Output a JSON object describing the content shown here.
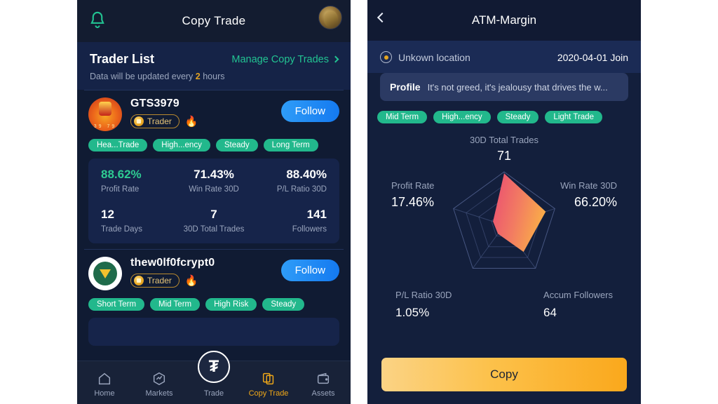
{
  "left": {
    "header": {
      "title": "Copy Trade",
      "bell_icon": "bell-icon",
      "avatar_icon": "user-avatar"
    },
    "list_header": {
      "title": "Trader List",
      "manage_label": "Manage Copy Trades",
      "subtitle_prefix": "Data will be updated every ",
      "subtitle_highlight": "2",
      "subtitle_suffix": " hours"
    },
    "traders": [
      {
        "name": "GTS3979",
        "badge_label": "Trader",
        "hot_icon": "flame-icon",
        "follow_label": "Follow",
        "avatar_caption": "39  79",
        "tags": [
          "Hea...Trade",
          "High...ency",
          "Steady",
          "Long Term"
        ],
        "stats_row1": [
          {
            "value": "88.62%",
            "label": "Profit Rate",
            "accent": "green"
          },
          {
            "value": "71.43%",
            "label": "Win Rate 30D",
            "accent": "white"
          },
          {
            "value": "88.40%",
            "label": "P/L Ratio 30D",
            "accent": "white"
          }
        ],
        "stats_row2": [
          {
            "value": "12",
            "label": "Trade Days",
            "accent": "white"
          },
          {
            "value": "7",
            "label": "30D Total Trades",
            "accent": "white"
          },
          {
            "value": "141",
            "label": "Followers",
            "accent": "white"
          }
        ]
      },
      {
        "name": "thew0lf0fcrypt0",
        "badge_label": "Trader",
        "hot_icon": "flame-icon",
        "follow_label": "Follow",
        "tags": [
          "Short Term",
          "Mid Term",
          "High Risk",
          "Steady"
        ]
      }
    ],
    "nav": {
      "fab_label": "₮",
      "items": [
        {
          "label": "Home",
          "icon": "home-icon",
          "active": false
        },
        {
          "label": "Markets",
          "icon": "markets-icon",
          "active": false
        },
        {
          "label": "Trade",
          "icon": "trade-icon",
          "active": false
        },
        {
          "label": "Copy Trade",
          "icon": "copy-trade-icon",
          "active": true
        },
        {
          "label": "Assets",
          "icon": "wallet-icon",
          "active": false
        }
      ]
    }
  },
  "right": {
    "header": {
      "title": "ATM-Margin",
      "back_icon": "chevron-left-icon"
    },
    "location": {
      "icon": "map-pin-icon",
      "text": "Unkown location",
      "join_date": "2020-04-01 Join"
    },
    "profile": {
      "key": "Profile",
      "value": "It's not greed, it's jealousy that drives the w..."
    },
    "tags": [
      "Mid Term",
      "High...ency",
      "Steady",
      "Light Trade"
    ],
    "total_trades": {
      "label": "30D Total Trades",
      "value": "71"
    },
    "side_left": {
      "label": "Profit Rate",
      "value": "17.46%"
    },
    "side_right": {
      "label": "Win Rate 30D",
      "value": "66.20%"
    },
    "bottom_left": {
      "label": "P/L Ratio 30D",
      "value": "1.05%"
    },
    "bottom_right": {
      "label": "Accum Followers",
      "value": "64"
    },
    "copy_label": "Copy"
  },
  "chart_data": {
    "type": "radar",
    "title": "Trader performance radar",
    "axes": [
      "30D Total Trades",
      "Win Rate 30D",
      "Accum Followers",
      "P/L Ratio 30D",
      "Profit Rate"
    ],
    "values": [
      0.97,
      0.82,
      0.62,
      0.2,
      0.22
    ],
    "rings": 4,
    "range": [
      0,
      1
    ],
    "grid": true,
    "fill_start": "#ea4b73",
    "fill_end": "#f9a94a",
    "grid_color": "#4a5a86",
    "legend": "none"
  },
  "colors": {
    "accent_green": "#22c392",
    "tag_green": "#22b88c",
    "follow_blue": "#1479f0",
    "gold": "#e3a322",
    "nav_active": "#f0a818",
    "panel_bg": "#101b33",
    "card_bg": "#16244a"
  }
}
